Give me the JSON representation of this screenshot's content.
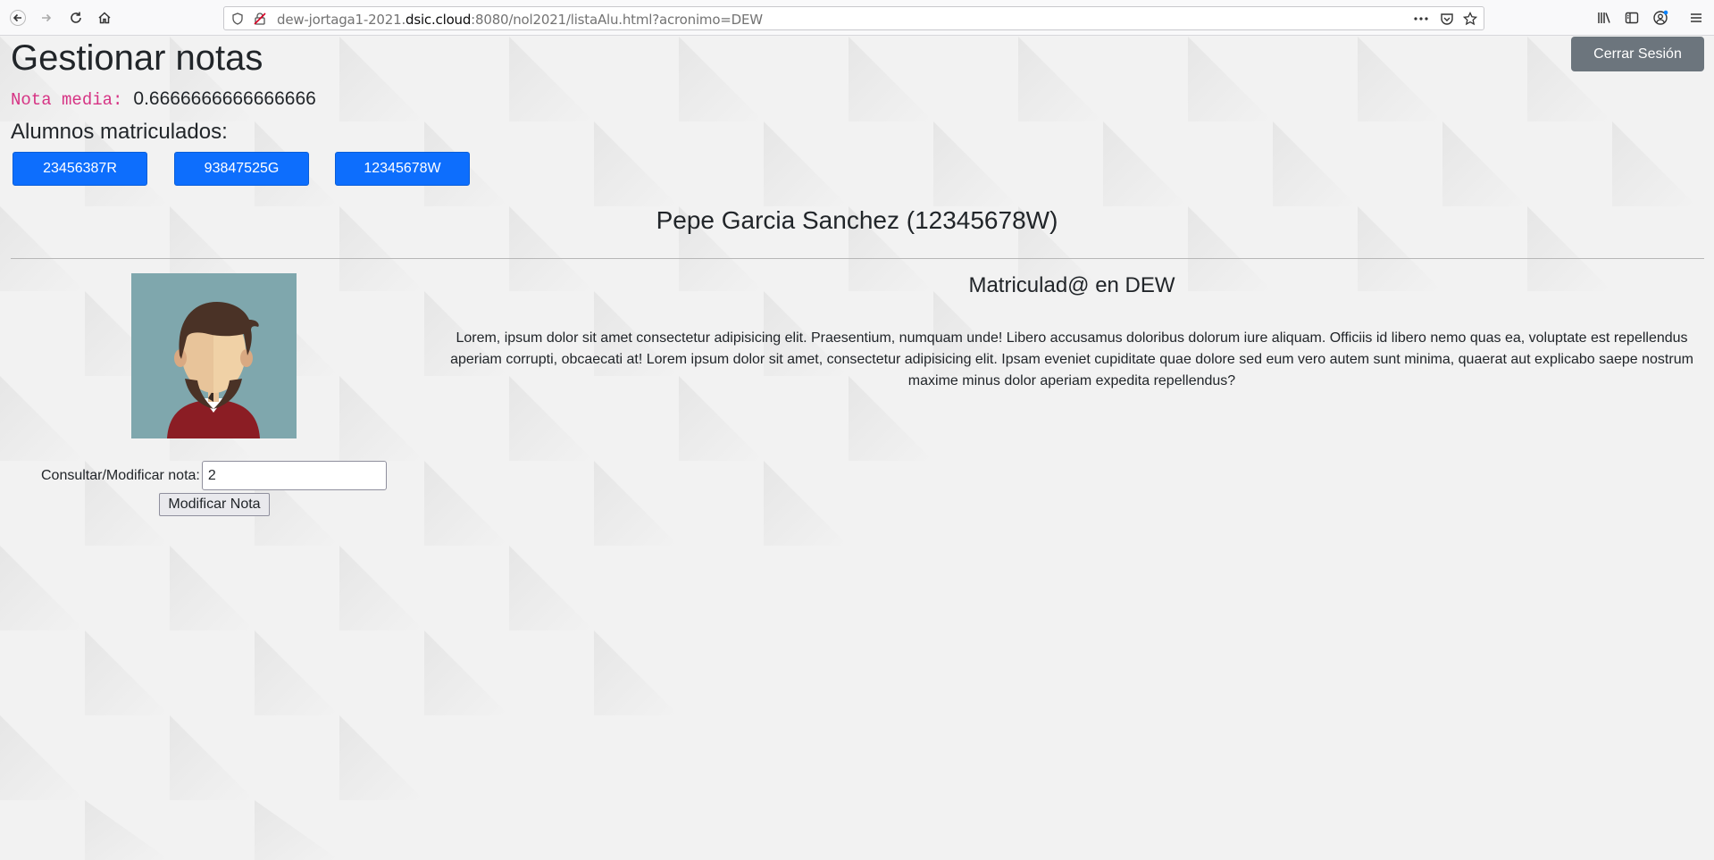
{
  "browser": {
    "url_prefix": "dew-jortaga1-2021.",
    "url_domain": "dsic.cloud",
    "url_suffix": ":8080/nol2021/listaAlu.html?acronimo=DEW"
  },
  "header": {
    "title": "Gestionar notas",
    "logout_label": "Cerrar Sesión"
  },
  "average": {
    "label": "Nota media:",
    "value": "0.6666666666666666"
  },
  "students": {
    "heading": "Alumnos matriculados:",
    "items": [
      "23456387R",
      "93847525G",
      "12345678W"
    ]
  },
  "selected_student": {
    "name": "Pepe Garcia Sanchez (12345678W)",
    "enrolled_heading": "Matriculad@ en DEW",
    "description": "Lorem, ipsum dolor sit amet consectetur adipisicing elit. Praesentium, numquam unde! Libero accusamus doloribus dolorum iure aliquam. Officiis id libero nemo quas ea, voluptate est repellendus aperiam corrupti, obcaecati at! Lorem ipsum dolor sit amet, consectetur adipisicing elit. Ipsam eveniet cupiditate quae dolore sed eum vero autem sunt minima, quaerat aut explicabo saepe nostrum maxime minus dolor aperiam expedita repellendus?"
  },
  "grade_form": {
    "label": "Consultar/Modificar nota:",
    "value": "2",
    "submit_label": "Modificar Nota"
  },
  "colors": {
    "primary": "#0d6efd",
    "secondary": "#6c757d",
    "code_pink": "#d63384",
    "avatar_bg": "#7fa7ad"
  }
}
